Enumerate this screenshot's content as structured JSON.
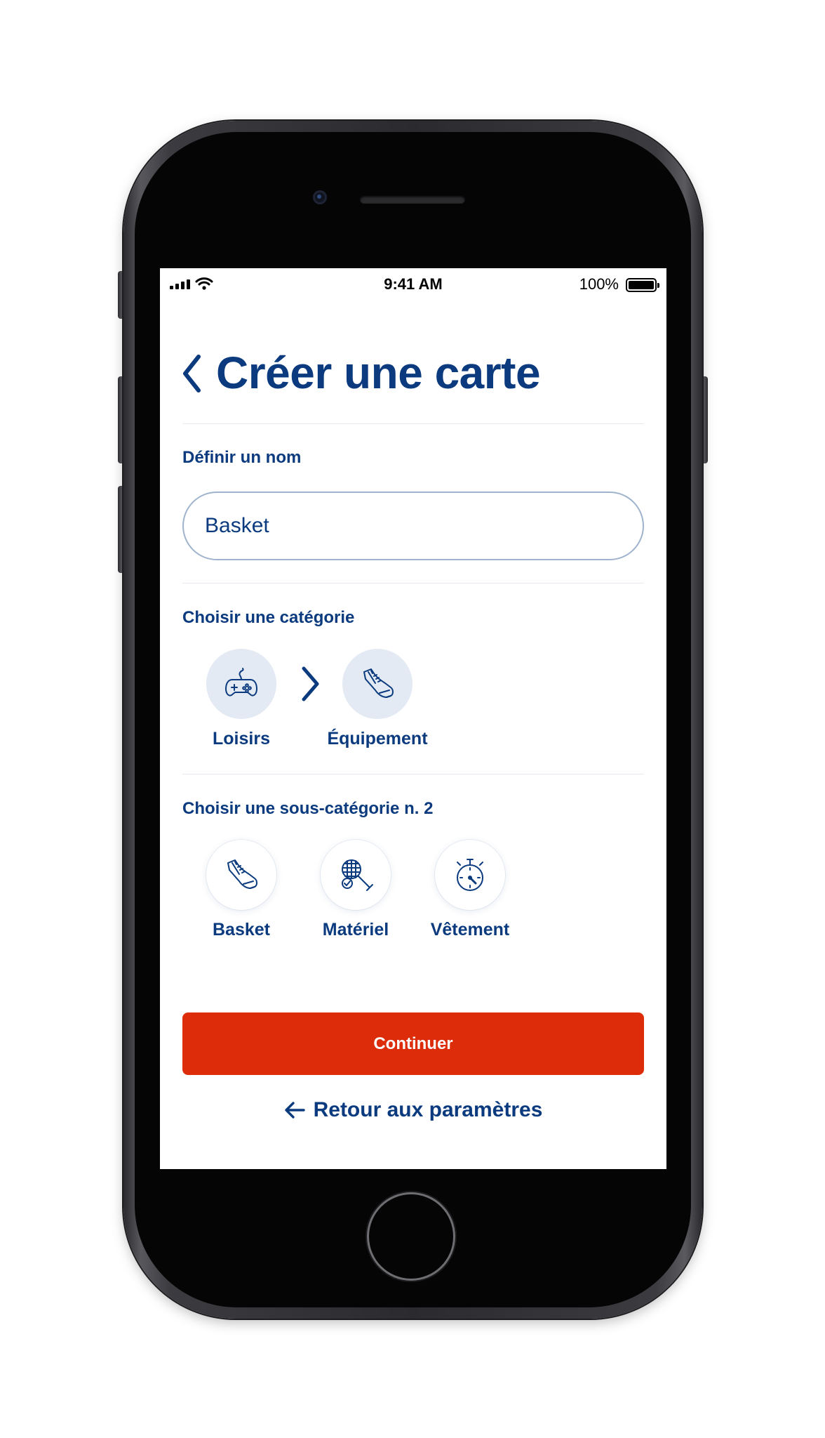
{
  "status_bar": {
    "time": "9:41 AM",
    "battery": "100%"
  },
  "header": {
    "title": "Créer une carte"
  },
  "name_section": {
    "label": "Définir un nom",
    "value": "Basket"
  },
  "category_section": {
    "label": "Choisir une catégorie",
    "path": [
      {
        "label": "Loisirs",
        "icon": "gamepad-icon"
      },
      {
        "label": "Équipement",
        "icon": "sneaker-icon"
      }
    ]
  },
  "subcategory_section": {
    "label": "Choisir une sous-catégorie n. 2",
    "items": [
      {
        "label": "Basket",
        "icon": "sneaker-icon"
      },
      {
        "label": "Matériel",
        "icon": "tennis-racket-icon"
      },
      {
        "label": "Vêtement",
        "icon": "stopwatch-icon"
      }
    ]
  },
  "actions": {
    "continue_label": "Continuer",
    "back_label": "Retour aux paramètres"
  },
  "colors": {
    "primary": "#0b3b7e",
    "accent": "#dd2c09",
    "icon_bg": "#e3eaf3"
  }
}
